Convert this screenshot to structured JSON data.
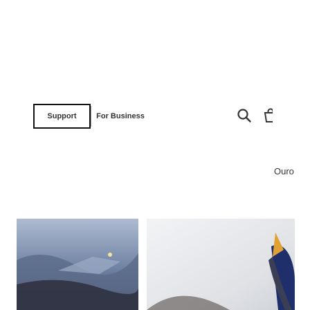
{
  "nav": {
    "support_label": "Support",
    "business_label": "For Business"
  },
  "icons": {
    "search": "search-icon",
    "cart": "shopping-bag-icon"
  },
  "content": {
    "gold_text": "Ouro"
  },
  "colors": {
    "border": "#111111",
    "divider": "#999999",
    "banner_gradient_start": "#8fa3bf",
    "banner_gradient_end": "#3a2f2c"
  }
}
